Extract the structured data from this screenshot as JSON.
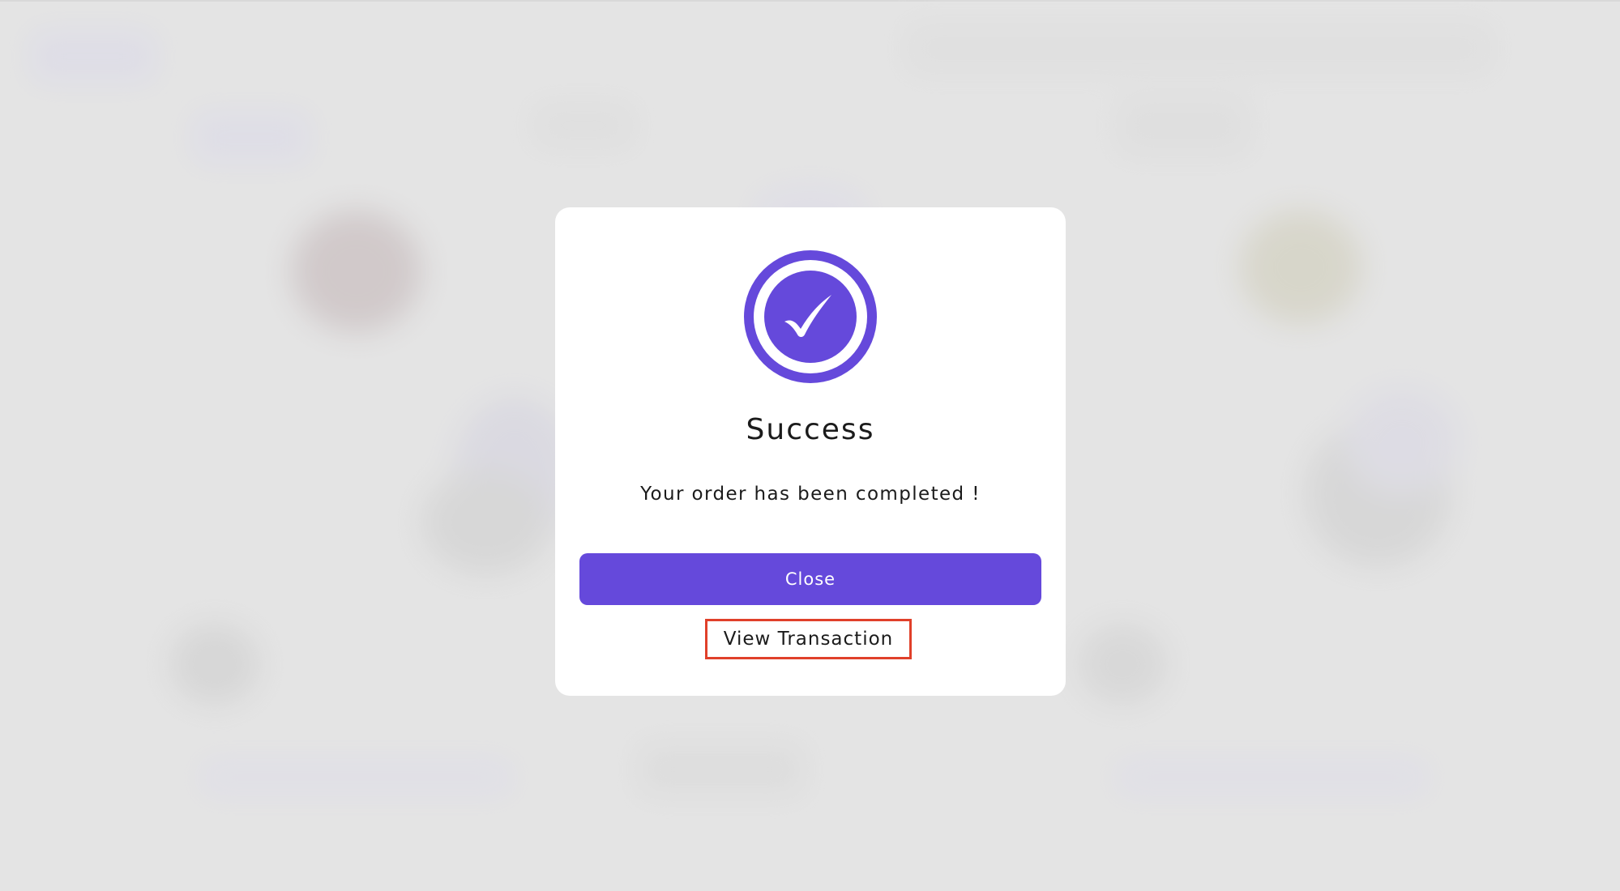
{
  "modal": {
    "icon": "check-circle-icon",
    "title": "Success",
    "message": "Your order has been completed !",
    "close_label": "Close",
    "view_transaction_label": "View Transaction"
  },
  "colors": {
    "accent": "#6549db",
    "highlight_outline": "#e0402a",
    "backdrop": "#e6e6e6",
    "modal_background": "#ffffff"
  }
}
